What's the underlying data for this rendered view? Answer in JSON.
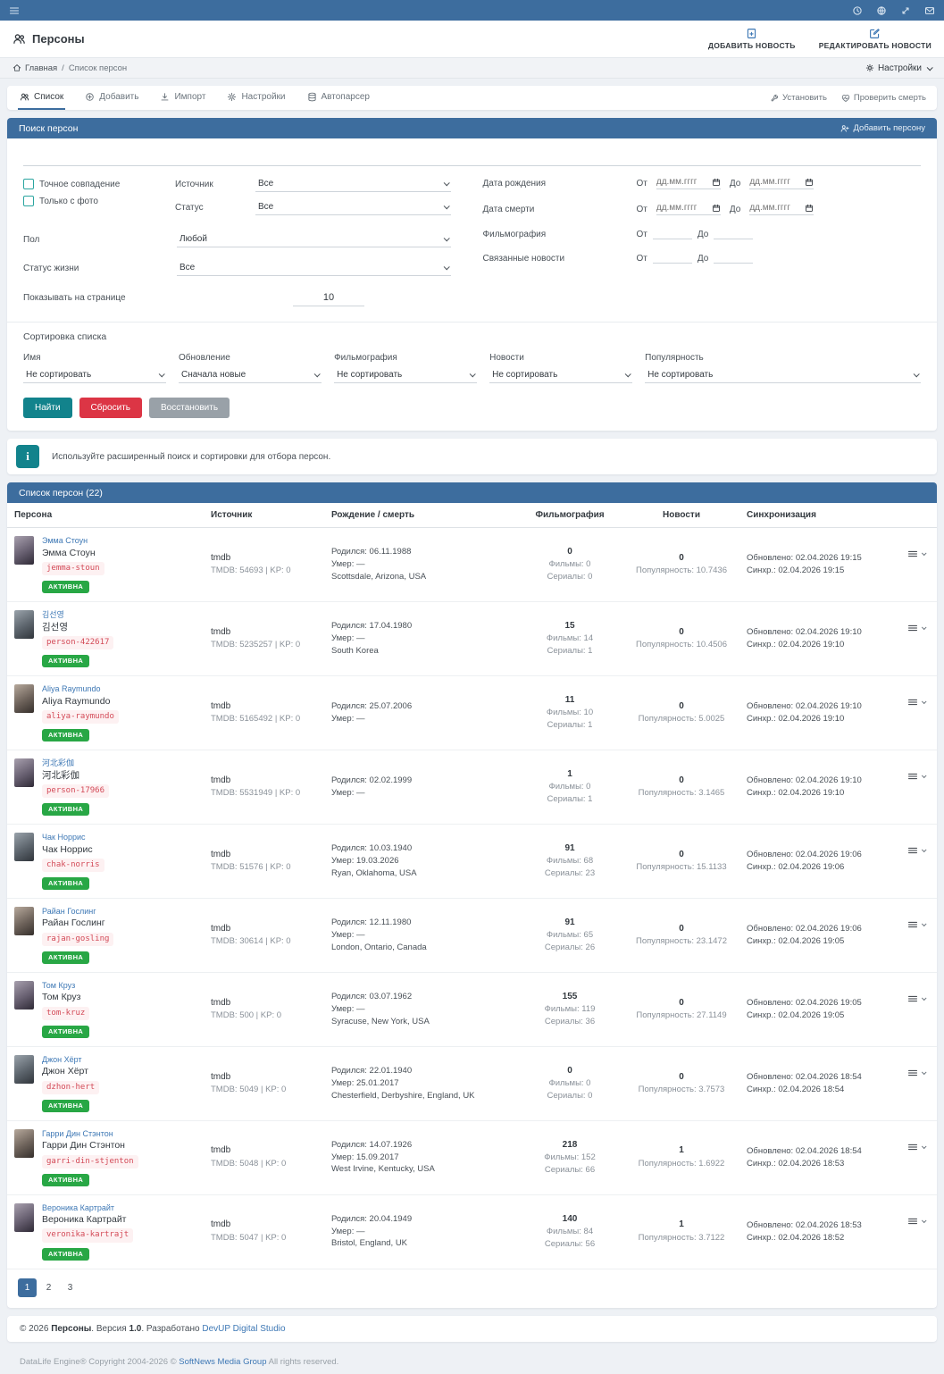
{
  "navbar": {
    "icons": [
      "menu-icon",
      "history-icon",
      "globe-icon",
      "fullscreen-icon",
      "mail-icon"
    ]
  },
  "header": {
    "title": "Персоны",
    "add_news": "ДОБАВИТЬ НОВОСТЬ",
    "edit_news": "РЕДАКТИРОВАТЬ НОВОСТИ"
  },
  "breadcrumb": {
    "home": "Главная",
    "separator": "/",
    "current": "Список персон",
    "settings": "Настройки"
  },
  "tabs": [
    {
      "label": "Список",
      "active": true
    },
    {
      "label": "Добавить",
      "active": false
    },
    {
      "label": "Импорт",
      "active": false
    },
    {
      "label": "Настройки",
      "active": false
    },
    {
      "label": "Автопарсер",
      "active": false
    }
  ],
  "tab_actions": {
    "install": "Установить",
    "check_death": "Проверить смерть"
  },
  "search": {
    "panel_title": "Поиск персон",
    "add_person": "Добавить персону",
    "exact_match": "Точное совпадение",
    "only_photo": "Только с фото",
    "source_label": "Источник",
    "source_value": "Все",
    "status_label": "Статус",
    "status_value": "Все",
    "gender_label": "Пол",
    "gender_value": "Любой",
    "life_status_label": "Статус жизни",
    "life_status_value": "Все",
    "per_page_label": "Показывать на странице",
    "per_page": "10",
    "birth_label": "Дата рождения",
    "death_label": "Дата смерти",
    "filmography_label": "Фильмография",
    "related_news_label": "Связанные новости",
    "from_label": "От",
    "to_label": "До",
    "date_placeholder": "дд.мм.гггг",
    "sort_title": "Сортировка списка",
    "sort_fields": [
      {
        "label": "Имя",
        "value": "Не сортировать"
      },
      {
        "label": "Обновление",
        "value": "Сначала новые"
      },
      {
        "label": "Фильмография",
        "value": "Не сортировать"
      },
      {
        "label": "Новости",
        "value": "Не сортировать"
      },
      {
        "label": "Популярность",
        "value": "Не сортировать"
      }
    ],
    "find_btn": "Найти",
    "reset_btn": "Сбросить",
    "restore_btn": "Восстановить"
  },
  "alert": {
    "text": "Используйте расширенный поиск и сортировки для отбора персон."
  },
  "table": {
    "title": "Список персон (22)",
    "columns": [
      "Персона",
      "Источник",
      "Рождение / смерть",
      "Фильмография",
      "Новости",
      "Синхронизация"
    ],
    "rows": [
      {
        "link_name": "Эмма Стоун",
        "name": "Эмма Стоун",
        "code": "jemma-stoun",
        "status": "АКТИВНА",
        "source": "tmdb",
        "source_ids": "TMDB: 54693 | KP: 0",
        "born": "Родился: 06.11.1988",
        "died": "Умер: —",
        "place": "Scottsdale, Arizona, USA",
        "films_total": "0",
        "films": "Фильмы: 0",
        "series": "Сериалы: 0",
        "news_count": "0",
        "popularity": "Популярность: 10.7436",
        "updated": "Обновлено: 02.04.2026 19:15",
        "synced": "Синхр.: 02.04.2026 19:15"
      },
      {
        "link_name": "김선영",
        "name": "김선영",
        "code": "person-422617",
        "status": "АКТИВНА",
        "source": "tmdb",
        "source_ids": "TMDB: 5235257 | KP: 0",
        "born": "Родился: 17.04.1980",
        "died": "Умер: —",
        "place": "South Korea",
        "films_total": "15",
        "films": "Фильмы: 14",
        "series": "Сериалы: 1",
        "news_count": "0",
        "popularity": "Популярность: 10.4506",
        "updated": "Обновлено: 02.04.2026 19:10",
        "synced": "Синхр.: 02.04.2026 19:10"
      },
      {
        "link_name": "Aliya Raymundo",
        "name": "Aliya Raymundo",
        "code": "aliya-raymundo",
        "status": "АКТИВНА",
        "source": "tmdb",
        "source_ids": "TMDB: 5165492 | KP: 0",
        "born": "Родился: 25.07.2006",
        "died": "Умер: —",
        "place": "",
        "films_total": "11",
        "films": "Фильмы: 10",
        "series": "Сериалы: 1",
        "news_count": "0",
        "popularity": "Популярность: 5.0025",
        "updated": "Обновлено: 02.04.2026 19:10",
        "synced": "Синхр.: 02.04.2026 19:10"
      },
      {
        "link_name": "河北彩伽",
        "name": "河北彩伽",
        "code": "person-17966",
        "status": "АКТИВНА",
        "source": "tmdb",
        "source_ids": "TMDB: 5531949 | KP: 0",
        "born": "Родился: 02.02.1999",
        "died": "Умер: —",
        "place": "",
        "films_total": "1",
        "films": "Фильмы: 0",
        "series": "Сериалы: 1",
        "news_count": "0",
        "popularity": "Популярность: 3.1465",
        "updated": "Обновлено: 02.04.2026 19:10",
        "synced": "Синхр.: 02.04.2026 19:10"
      },
      {
        "link_name": "Чак Норрис",
        "name": "Чак Норрис",
        "code": "chak-norris",
        "status": "АКТИВНА",
        "source": "tmdb",
        "source_ids": "TMDB: 51576 | KP: 0",
        "born": "Родился: 10.03.1940",
        "died": "Умер: 19.03.2026",
        "place": "Ryan, Oklahoma, USA",
        "films_total": "91",
        "films": "Фильмы: 68",
        "series": "Сериалы: 23",
        "news_count": "0",
        "popularity": "Популярность: 15.1133",
        "updated": "Обновлено: 02.04.2026 19:06",
        "synced": "Синхр.: 02.04.2026 19:06"
      },
      {
        "link_name": "Райан Гослинг",
        "name": "Райан Гослинг",
        "code": "rajan-gosling",
        "status": "АКТИВНА",
        "source": "tmdb",
        "source_ids": "TMDB: 30614 | KP: 0",
        "born": "Родился: 12.11.1980",
        "died": "Умер: —",
        "place": "London, Ontario, Canada",
        "films_total": "91",
        "films": "Фильмы: 65",
        "series": "Сериалы: 26",
        "news_count": "0",
        "popularity": "Популярность: 23.1472",
        "updated": "Обновлено: 02.04.2026 19:06",
        "synced": "Синхр.: 02.04.2026 19:05"
      },
      {
        "link_name": "Том Круз",
        "name": "Том Круз",
        "code": "tom-kruz",
        "status": "АКТИВНА",
        "source": "tmdb",
        "source_ids": "TMDB: 500 | KP: 0",
        "born": "Родился: 03.07.1962",
        "died": "Умер: —",
        "place": "Syracuse, New York, USA",
        "films_total": "155",
        "films": "Фильмы: 119",
        "series": "Сериалы: 36",
        "news_count": "0",
        "popularity": "Популярность: 27.1149",
        "updated": "Обновлено: 02.04.2026 19:05",
        "synced": "Синхр.: 02.04.2026 19:05"
      },
      {
        "link_name": "Джон Хёрт",
        "name": "Джон Хёрт",
        "code": "dzhon-hert",
        "status": "АКТИВНА",
        "source": "tmdb",
        "source_ids": "TMDB: 5049 | KP: 0",
        "born": "Родился: 22.01.1940",
        "died": "Умер: 25.01.2017",
        "place": "Chesterfield, Derbyshire, England, UK",
        "films_total": "0",
        "films": "Фильмы: 0",
        "series": "Сериалы: 0",
        "news_count": "0",
        "popularity": "Популярность: 3.7573",
        "updated": "Обновлено: 02.04.2026 18:54",
        "synced": "Синхр.: 02.04.2026 18:54"
      },
      {
        "link_name": "Гарри Дин Стэнтон",
        "name": "Гарри Дин Стэнтон",
        "code": "garri-din-stjenton",
        "status": "АКТИВНА",
        "source": "tmdb",
        "source_ids": "TMDB: 5048 | KP: 0",
        "born": "Родился: 14.07.1926",
        "died": "Умер: 15.09.2017",
        "place": "West Irvine, Kentucky, USA",
        "films_total": "218",
        "films": "Фильмы: 152",
        "series": "Сериалы: 66",
        "news_count": "1",
        "popularity": "Популярность: 1.6922",
        "updated": "Обновлено: 02.04.2026 18:54",
        "synced": "Синхр.: 02.04.2026 18:53"
      },
      {
        "link_name": "Вероника Картрайт",
        "name": "Вероника Картрайт",
        "code": "veronika-kartrajt",
        "status": "АКТИВНА",
        "source": "tmdb",
        "source_ids": "TMDB: 5047 | KP: 0",
        "born": "Родился: 20.04.1949",
        "died": "Умер: —",
        "place": "Bristol, England, UK",
        "films_total": "140",
        "films": "Фильмы: 84",
        "series": "Сериалы: 56",
        "news_count": "1",
        "popularity": "Популярность: 3.7122",
        "updated": "Обновлено: 02.04.2026 18:53",
        "synced": "Синхр.: 02.04.2026 18:52"
      }
    ]
  },
  "pagination": {
    "pages": [
      "1",
      "2",
      "3"
    ],
    "active": "1"
  },
  "footer": {
    "copyright": "© 2026",
    "app_name": "Персоны",
    "version_label": ". Версия",
    "version": "1.0",
    "developed": ". Разработано",
    "studio": "DevUP Digital Studio",
    "engine": "DataLife Engine® Copyright 2004-2026 ©",
    "engine_link": "SoftNews Media Group",
    "engine_rest": "All rights reserved."
  },
  "colors": {
    "accent_blue": "#3d6d9e",
    "teal": "#12838c",
    "danger": "#dc3545",
    "success": "#28a745",
    "code_red": "#d34a57",
    "link_blue": "#3e78b5"
  }
}
